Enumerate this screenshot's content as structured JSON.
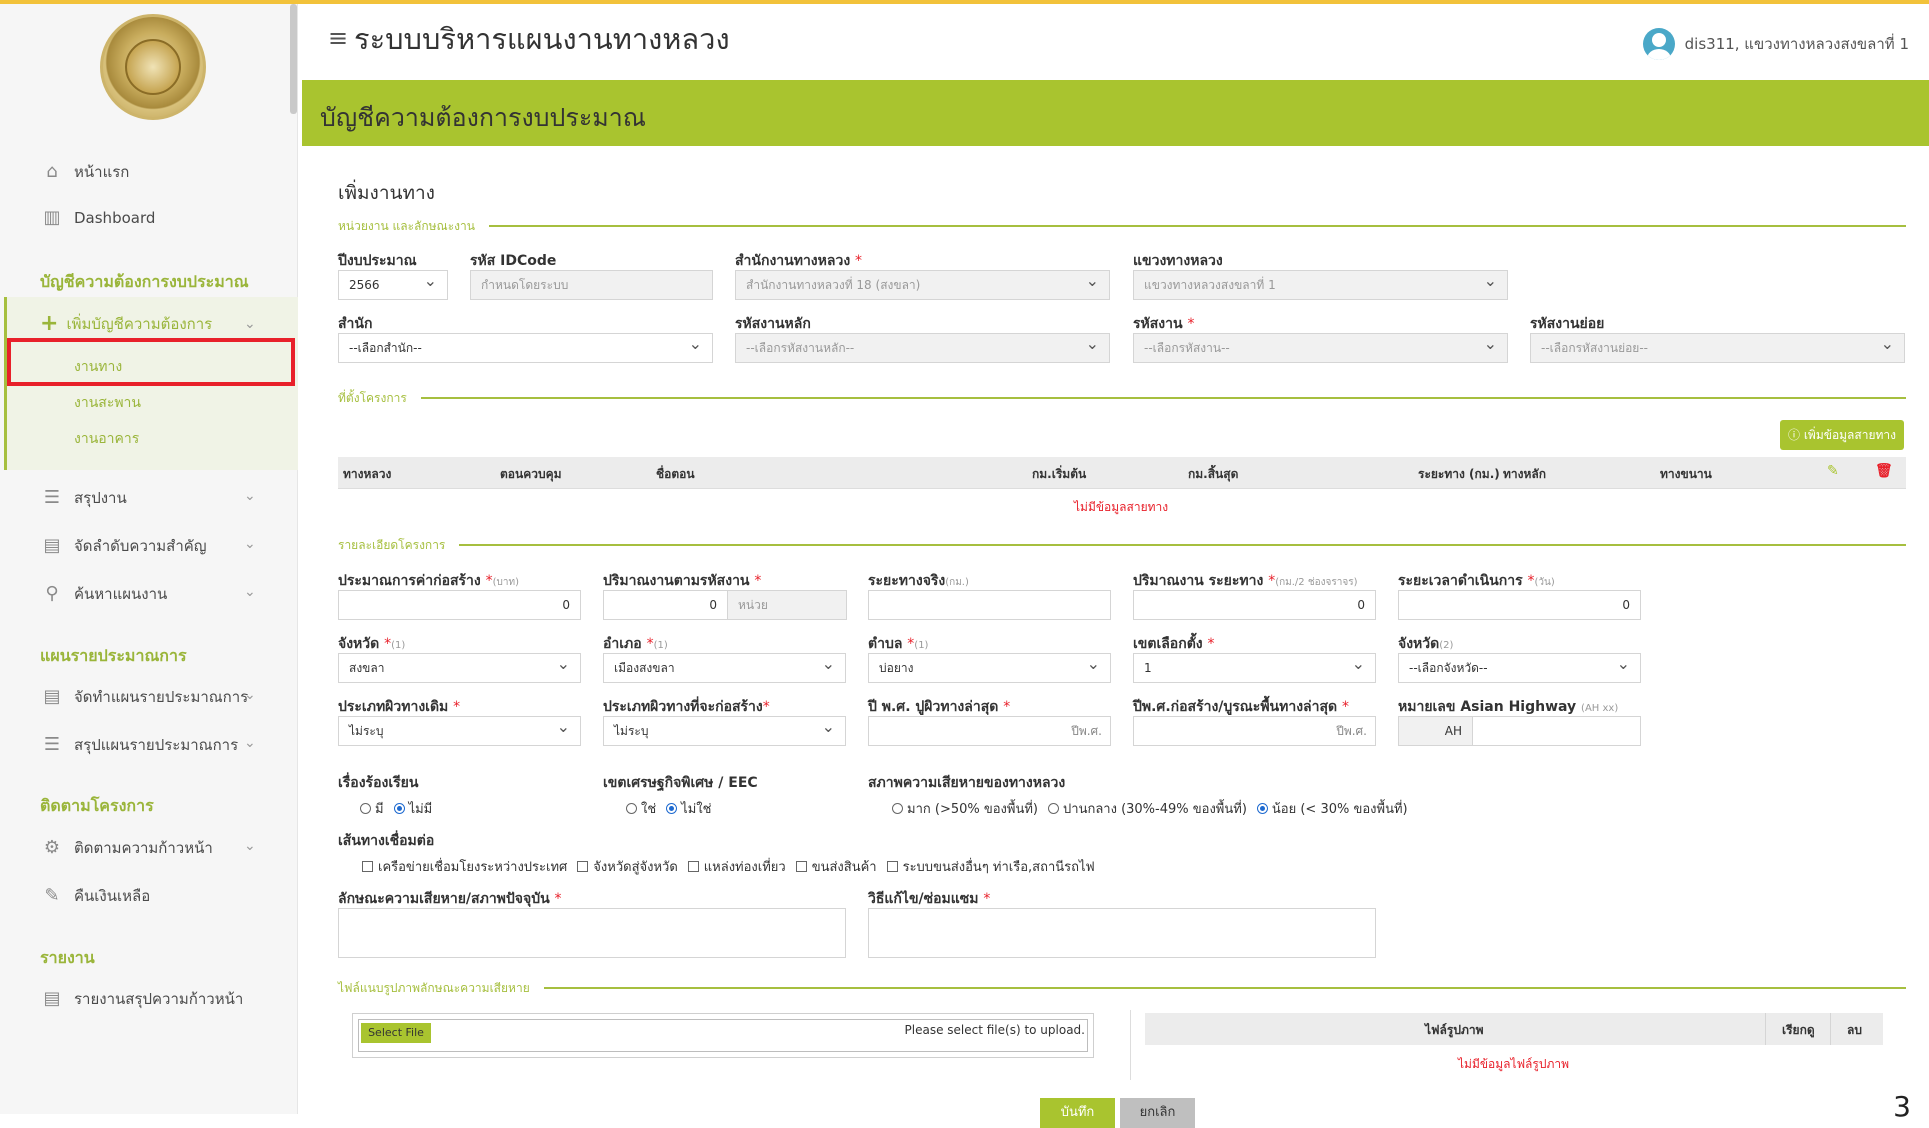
{
  "header": {
    "app_title": "ระบบบริหารแผนงานทางหลวง",
    "user": "dis311, แขวงทางหลวงสงขลาที่ 1"
  },
  "sidebar": {
    "home": "หน้าแรก",
    "dashboard": "Dashboard",
    "sec_budget": "บัญชีความต้องการงบประมาณ",
    "add_budget": "เพิ่มบัญชีความต้องการ",
    "sub_road": "งานทาง",
    "sub_bridge": "งานสะพาน",
    "sub_building": "งานอาคาร",
    "summary": "สรุปงาน",
    "priority": "จัดลำดับความสำคัญ",
    "search": "ค้นหาแผนงาน",
    "sec_plan": "แผนรายประมาณการ",
    "make_plan": "จัดทำแผนรายประมาณการ",
    "sum_plan": "สรุปแผนรายประมาณการ",
    "sec_track": "ติดตามโครงการ",
    "track_progress": "ติดตามความก้าวหน้า",
    "refund": "คืนเงินเหลือ",
    "sec_report": "รายงาน",
    "report_progress": "รายงานสรุปความก้าวหน้า"
  },
  "page": {
    "title": "บัญชีความต้องการงบประมาณ",
    "form_title": "เพิ่มงานทาง"
  },
  "sections": {
    "unit": "หน่วยงาน และลักษณะงาน",
    "location": "ที่ตั้งโครงการ",
    "detail": "รายละเอียดโครงการ",
    "attach": "ไฟล์แนบรูปภาพลักษณะความเสียหาย"
  },
  "fields": {
    "fy_label": "ปีงบประมาณ",
    "fy_value": "2566",
    "idcode_label": "รหัส IDCode",
    "idcode_value": "กำหนดโดยระบบ",
    "office_label": "สำนักงานทางหลวง",
    "office_value": "สำนักงานทางหลวงที่ 18 (สงขลา)",
    "district_label": "แขวงทางหลวง",
    "district_value": "แขวงทางหลวงสงขลาที่ 1",
    "bureau_label": "สำนัก",
    "bureau_value": "--เลือกสำนัก--",
    "mainwork_label": "รหัสงานหลัก",
    "mainwork_value": "--เลือกรหัสงานหลัก--",
    "work_label": "รหัสงาน",
    "work_value": "--เลือกรหัสงาน--",
    "subwork_label": "รหัสงานย่อย",
    "subwork_value": "--เลือกรหัสงานย่อย--",
    "cost_label": "ประมาณการค่าก่อสร้าง",
    "cost_hint": "(บาท)",
    "cost_value": "0",
    "qty_label": "ปริมาณงานตามรหัสงาน",
    "qty_value": "0",
    "qty_unit": "หน่วย",
    "dist_label": "ระยะทางจริง",
    "dist_hint": "(กม.)",
    "dist_value": "",
    "qtydist_label": "ปริมาณงาน ระยะทาง",
    "qtydist_hint": "(กม./2 ช่องจราจร)",
    "qtydist_value": "0",
    "duration_label": "ระยะเวลาดำเนินการ",
    "duration_hint": "(วัน)",
    "duration_value": "0",
    "province_label": "จังหวัด",
    "province_hint": "(1)",
    "province_value": "สงขลา",
    "amphoe_label": "อำเภอ",
    "amphoe_hint": "(1)",
    "amphoe_value": "เมืองสงขลา",
    "tambon_label": "ตำบล",
    "tambon_hint": "(1)",
    "tambon_value": "บ่อยาง",
    "constituency_label": "เขตเลือกตั้ง",
    "constituency_value": "1",
    "province2_label": "จังหวัด",
    "province2_hint": "(2)",
    "province2_value": "--เลือกจังหวัด--",
    "surf_old_label": "ประเภทผิวทางเดิม",
    "surf_old_value": "ไม่ระบุ",
    "surf_new_label": "ประเภทผิวทางที่จะก่อสร้าง",
    "surf_new_value": "ไม่ระบุ",
    "lastfix_label": "ปี พ.ศ. ปูผิวทางล่าสุด",
    "lastfix_unit": "ปีพ.ศ.",
    "lastbuild_label": "ปีพ.ศ.ก่อสร้าง/บูรณะพื้นทางล่าสุด",
    "lastbuild_unit": "ปีพ.ศ.",
    "ah_label": "หมายเลข Asian Highway",
    "ah_hint": "(AH xx)",
    "ah_prefix": "AH",
    "complaint_label": "เรื่องร้องเรียน",
    "complaint_yes": "มี",
    "complaint_no": "ไม่มี",
    "eec_label": "เขตเศรษฐกิจพิเศษ / EEC",
    "eec_yes": "ใช่",
    "eec_no": "ไม่ใช่",
    "damage_label": "สภาพความเสียหายของทางหลวง",
    "damage_high": "มาก (>50% ของพื้นที่)",
    "damage_mid": "ปานกลาง (30%-49% ของพื้นที่)",
    "damage_low": "น้อย (< 30% ของพื้นที่)",
    "connect_label": "เส้นทางเชื่อมต่อ",
    "connect_1": "เครือข่ายเชื่อมโยงระหว่างประเทศ",
    "connect_2": "จังหวัดสู่จังหวัด",
    "connect_3": "แหล่งท่องเที่ยว",
    "connect_4": "ขนส่งสินค้า",
    "connect_5": "ระบบขนส่งอื่นๆ ท่าเรือ,สถานีรถไฟ",
    "damage_desc_label": "ลักษณะความเสียหาย/สภาพปัจจุบัน",
    "fix_method_label": "วิธีแก้ไข/ซ่อมแซม"
  },
  "route_table": {
    "add_button": "เพิ่มข้อมูลสายทาง",
    "headers": [
      "ทางหลวง",
      "ตอนควบคุม",
      "ชื่อตอน",
      "กม.เริ่มต้น",
      "กม.สิ้นสุด",
      "ระยะทาง (กม.)",
      "ทางหลัก",
      "ทางขนาน"
    ],
    "empty": "ไม่มีข้อมูลสายทาง"
  },
  "upload": {
    "select_button": "Select File",
    "message": "Please select file(s) to upload.",
    "headers": [
      "ไฟล์รูปภาพ",
      "เรียกดู",
      "ลบ"
    ],
    "empty": "ไม่มีข้อมูลไฟล์รูปภาพ"
  },
  "actions": {
    "save": "บันทึก",
    "cancel": "ยกเลิก"
  },
  "page_number": "3",
  "colors": {
    "accent": "#a9c42f",
    "required": "#e8202a",
    "highlight": "#e8202a"
  }
}
